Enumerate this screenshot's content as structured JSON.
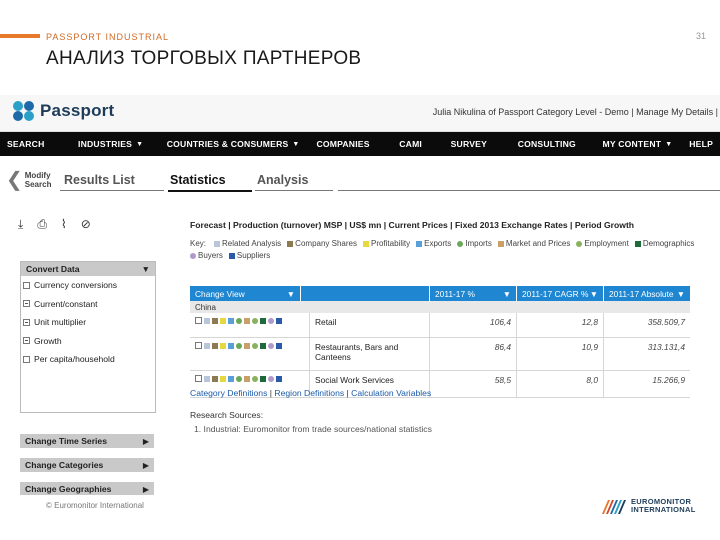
{
  "slide": {
    "kicker": "PASSPORT INDUSTRIAL",
    "title": "АНАЛИЗ ТОРГОВЫХ ПАРТНЕРОВ",
    "page_number": "31",
    "copyright": "© Euromonitor International",
    "footer_logo_line1": "EUROMONITOR",
    "footer_logo_line2": "INTERNATIONAL"
  },
  "app": {
    "logo": "Passport",
    "user_line": "Julia Nikulina of Passport Category Level - Demo | Manage My Details |",
    "nav": [
      "SEARCH",
      "INDUSTRIES",
      "COUNTRIES & CONSUMERS",
      "COMPANIES",
      "CAMI",
      "SURVEY",
      "CONSULTING",
      "MY CONTENT",
      "HELP"
    ],
    "modify_line1": "Modify",
    "modify_line2": "Search",
    "tabs": [
      "Results List",
      "Statistics",
      "Analysis"
    ],
    "active_tab": "Statistics"
  },
  "left_panel": {
    "convert_title": "Convert Data",
    "options": [
      "Currency conversions",
      "Current/constant",
      "Unit multiplier",
      "Growth",
      "Per capita/household"
    ],
    "sections": [
      "Change Time Series",
      "Change Categories",
      "Change Geographies"
    ]
  },
  "main": {
    "breadcrumb": "Forecast | Production (turnover) MSP | US$ mn | Current Prices | Fixed 2013 Exchange Rates | Period Growth",
    "key_label": "Key:",
    "key_items": [
      {
        "label": "Related Analysis",
        "color": "#b8c6d8"
      },
      {
        "label": "Company Shares",
        "color": "#8b7a52"
      },
      {
        "label": "Profitability",
        "color": "#e6d840"
      },
      {
        "label": "Exports",
        "color": "#5aa0d8"
      },
      {
        "label": "Imports",
        "color": "#6aa85a"
      },
      {
        "label": "Market and Prices",
        "color": "#c9a06a"
      },
      {
        "label": "Employment",
        "color": "#8ab060"
      },
      {
        "label": "Demographics",
        "color": "#1e6a3a"
      },
      {
        "label": "Buyers",
        "color": "#b09aca"
      },
      {
        "label": "Suppliers",
        "color": "#2a5aa8"
      }
    ],
    "grid": {
      "change_view": "Change View",
      "columns": [
        "2011-17 %",
        "2011-17 CAGR %",
        "2011-17 Absolute"
      ],
      "country": "China",
      "rows": [
        {
          "name": "Retail",
          "pct": "106,4",
          "cagr": "12,8",
          "abs": "358.509,7"
        },
        {
          "name": "Restaurants, Bars and Canteens",
          "pct": "86,4",
          "cagr": "10,9",
          "abs": "313.131,4"
        },
        {
          "name": "Social Work Services",
          "pct": "58,5",
          "cagr": "8,0",
          "abs": "15.266,9"
        }
      ]
    },
    "links": [
      "Category Definitions",
      "Region Definitions",
      "Calculation Variables"
    ],
    "research_title": "Research Sources:",
    "research_item": "1.  Industrial: Euromonitor from trade sources/national statistics"
  }
}
